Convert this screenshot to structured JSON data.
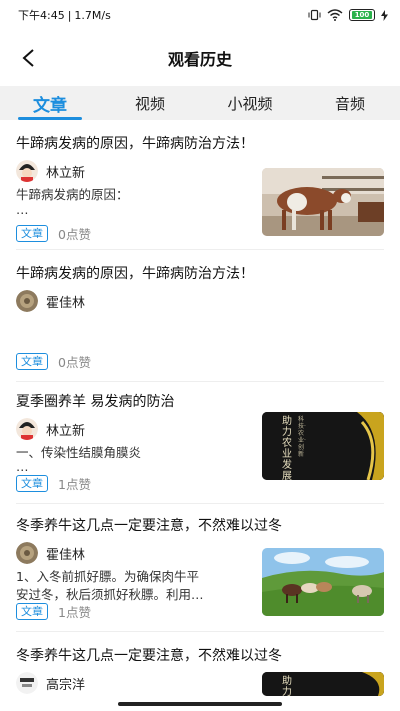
{
  "status": {
    "time": "下午4:45",
    "speed": "1.7M/s",
    "battery": "100"
  },
  "header": {
    "title": "观看历史"
  },
  "tabs": [
    {
      "label": "文章",
      "active": true
    },
    {
      "label": "视频",
      "active": false
    },
    {
      "label": "小视频",
      "active": false
    },
    {
      "label": "音频",
      "active": false
    }
  ],
  "items": [
    {
      "title": "牛蹄病发病的原因，牛蹄病防治方法！",
      "author": "林立新",
      "excerpt_lines": [
        "牛蹄病发病的原因：",
        "…"
      ],
      "tag": "文章",
      "likes": "0点赞",
      "thumb": "cow"
    },
    {
      "title": "牛蹄病发病的原因，牛蹄病防治方法！",
      "author": "霍佳林",
      "excerpt_lines": [],
      "tag": "文章",
      "likes": "0点赞",
      "thumb": ""
    },
    {
      "title": "夏季圈养羊 易发病的防治",
      "author": "林立新",
      "excerpt_lines": [
        "一、传染性结膜角膜炎",
        "…"
      ],
      "tag": "文章",
      "likes": "1点赞",
      "thumb": "banner",
      "thumb_text_col1": "助力农业发展",
      "thumb_text_col2": "科技·农业·创新"
    },
    {
      "title": "冬季养牛这几点一定要注意，不然难以过冬",
      "author": "霍佳林",
      "excerpt_lines": [
        "1、入冬前抓好膘。为确保肉牛平",
        "安过冬，秋后须抓好秋膘。利用…"
      ],
      "tag": "文章",
      "likes": "1点赞",
      "thumb": "pasture"
    },
    {
      "title": "冬季养牛这几点一定要注意，不然难以过冬",
      "author": "高宗洋",
      "excerpt_lines": [],
      "tag": "",
      "likes": "",
      "thumb": "banner",
      "thumb_text_col1": "助力",
      "thumb_text_col2": ""
    }
  ],
  "colors": {
    "accent": "#1d8ede",
    "tab_bg": "#f1f1f1"
  }
}
